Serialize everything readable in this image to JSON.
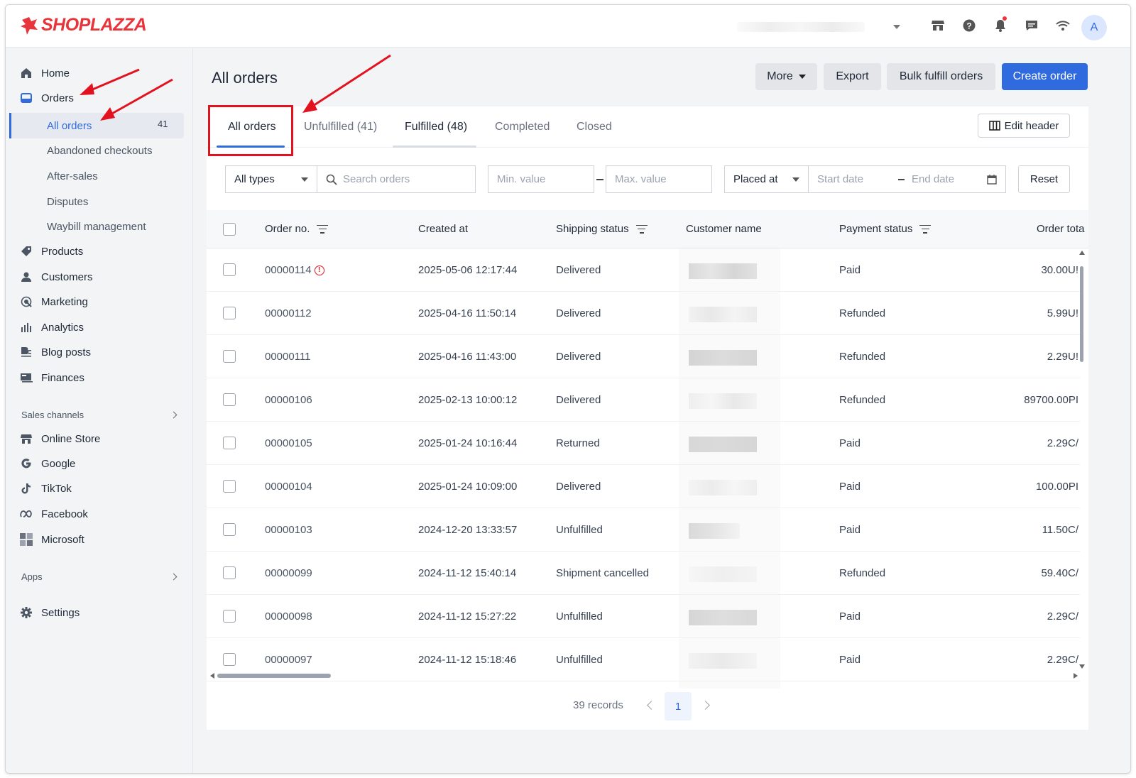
{
  "brand": {
    "name": "SHOPLAZZA",
    "color": "#e8343b"
  },
  "topbar": {
    "icons": [
      "store-icon",
      "help-icon",
      "bell-icon",
      "chat-icon",
      "wifi-icon"
    ],
    "avatar_initial": "A"
  },
  "sidebar": {
    "home": "Home",
    "orders": "Orders",
    "sub": {
      "all_orders": "All orders",
      "all_orders_count": "41",
      "abandoned": "Abandoned checkouts",
      "after_sales": "After-sales",
      "disputes": "Disputes",
      "waybill": "Waybill management"
    },
    "products": "Products",
    "customers": "Customers",
    "marketing": "Marketing",
    "analytics": "Analytics",
    "blog": "Blog posts",
    "finances": "Finances",
    "sales_channels": "Sales channels",
    "channels": {
      "online_store": "Online Store",
      "google": "Google",
      "tiktok": "TikTok",
      "facebook": "Facebook",
      "microsoft": "Microsoft"
    },
    "apps": "Apps",
    "settings": "Settings"
  },
  "page": {
    "title": "All orders",
    "buttons": {
      "more": "More",
      "export": "Export",
      "bulk": "Bulk fulfill orders",
      "create": "Create order"
    }
  },
  "tabs": {
    "all": "All orders",
    "unfulfilled": "Unfulfilled",
    "unfulfilled_count": "(41)",
    "fulfilled": "Fulfilled",
    "fulfilled_count": "(48)",
    "completed": "Completed",
    "closed": "Closed",
    "edit_header": "Edit header"
  },
  "filters": {
    "type": "All types",
    "search_placeholder": "Search orders",
    "min_placeholder": "Min. value",
    "max_placeholder": "Max. value",
    "date_field": "Placed at",
    "start_placeholder": "Start date",
    "end_placeholder": "End date",
    "reset": "Reset"
  },
  "table": {
    "headers": {
      "order_no": "Order no.",
      "created_at": "Created at",
      "shipping_status": "Shipping status",
      "customer_name": "Customer name",
      "payment_status": "Payment status",
      "order_total": "Order tota"
    },
    "rows": [
      {
        "order_no": "00000114",
        "created_at": "2025-05-06 12:17:44",
        "shipping": "Delivered",
        "payment": "Paid",
        "total": "30.00U!",
        "alert": true
      },
      {
        "order_no": "00000112",
        "created_at": "2025-04-16 11:50:14",
        "shipping": "Delivered",
        "payment": "Refunded",
        "total": "5.99U!"
      },
      {
        "order_no": "00000111",
        "created_at": "2025-04-16 11:43:00",
        "shipping": "Delivered",
        "payment": "Refunded",
        "total": "2.29U!"
      },
      {
        "order_no": "00000106",
        "created_at": "2025-02-13 10:00:12",
        "shipping": "Delivered",
        "payment": "Refunded",
        "total": "89700.00PI"
      },
      {
        "order_no": "00000105",
        "created_at": "2025-01-24 10:16:44",
        "shipping": "Returned",
        "payment": "Paid",
        "total": "2.29C/"
      },
      {
        "order_no": "00000104",
        "created_at": "2025-01-24 10:09:00",
        "shipping": "Delivered",
        "payment": "Paid",
        "total": "100.00PI"
      },
      {
        "order_no": "00000103",
        "created_at": "2024-12-20 13:33:57",
        "shipping": "Unfulfilled",
        "payment": "Paid",
        "total": "11.50C/"
      },
      {
        "order_no": "00000099",
        "created_at": "2024-11-12 15:40:14",
        "shipping": "Shipment cancelled",
        "payment": "Refunded",
        "total": "59.40C/"
      },
      {
        "order_no": "00000098",
        "created_at": "2024-11-12 15:27:22",
        "shipping": "Unfulfilled",
        "payment": "Paid",
        "total": "2.29C/"
      },
      {
        "order_no": "00000097",
        "created_at": "2024-11-12 15:18:46",
        "shipping": "Unfulfilled",
        "payment": "Paid",
        "total": "2.29C/"
      }
    ]
  },
  "pager": {
    "records": "39 records",
    "current_page": "1"
  },
  "colors": {
    "primary": "#2f6bde",
    "annotation": "#e3121f"
  }
}
